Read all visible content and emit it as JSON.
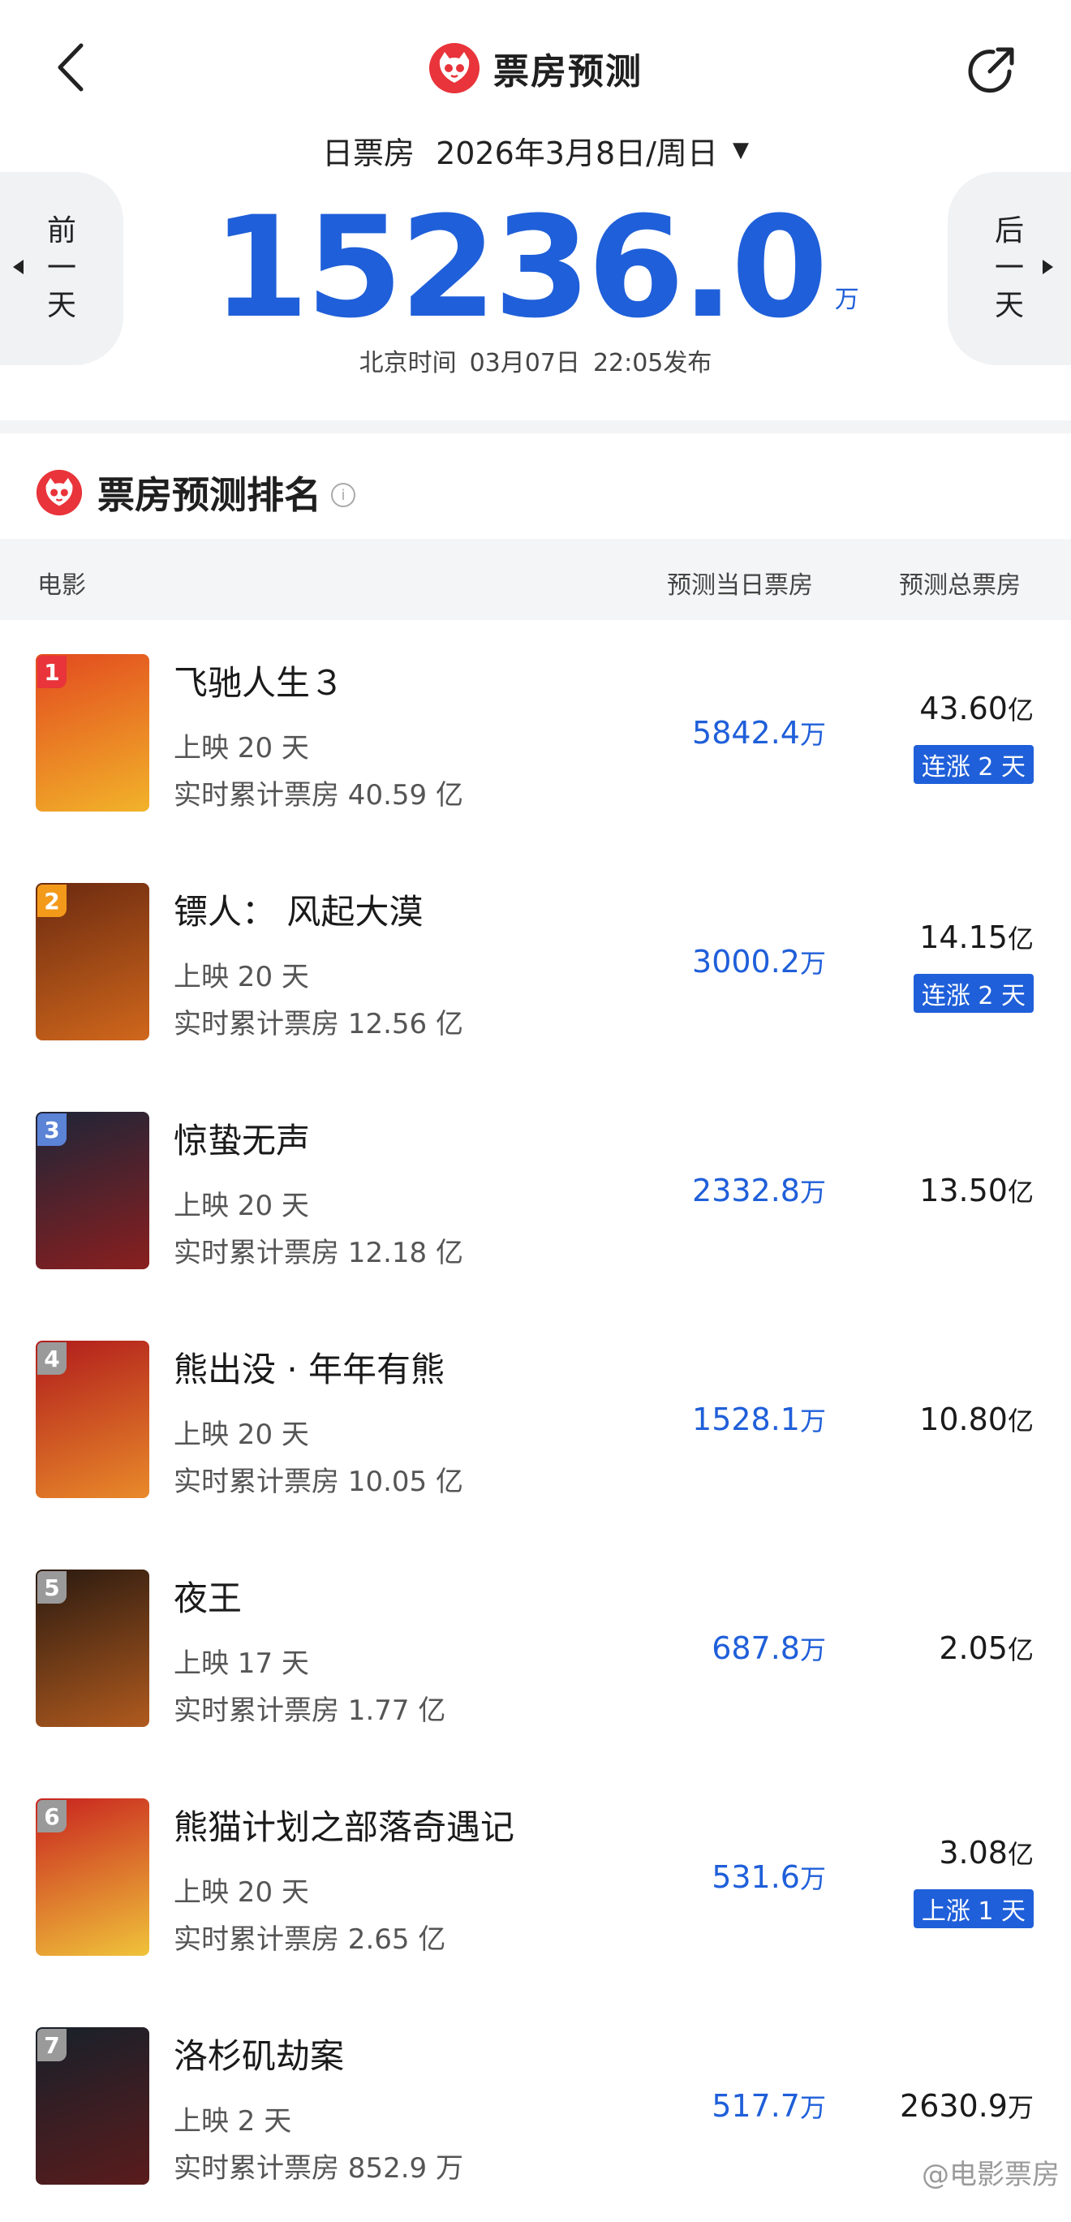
{
  "header": {
    "title": "票房预测",
    "back_icon": "chevron-left-icon",
    "share_icon": "share-icon",
    "logo": "cat-logo-icon"
  },
  "date_selector": {
    "label": "日票房",
    "value": "2026年3月8日/周日"
  },
  "nav": {
    "prev": [
      "前",
      "一",
      "天"
    ],
    "next": [
      "后",
      "一",
      "天"
    ]
  },
  "total": {
    "value": "15236.0",
    "unit": "万",
    "publish_label": "北京时间",
    "publish_date": "03月07日",
    "publish_time": "22:05发布"
  },
  "ranking": {
    "title": "票房预测排名",
    "columns": {
      "movie": "电影",
      "daily": "预测当日票房",
      "total": "预测总票房"
    },
    "movies": [
      {
        "rank": "1",
        "name": "飞驰人生３",
        "days": "上映 20 天",
        "cumulative": "实时累计票房 40.59 亿",
        "daily_value": "5842.4",
        "daily_unit": "万",
        "total_value": "43.60",
        "total_unit": "亿",
        "tag": "连涨 2 天",
        "badge_color": "#e8343a",
        "poster_colors": [
          "#e24a1f",
          "#f2b32a"
        ]
      },
      {
        "rank": "2",
        "name": "镖人： 风起大漠",
        "days": "上映 20 天",
        "cumulative": "实时累计票房 12.56 亿",
        "daily_value": "3000.2",
        "daily_unit": "万",
        "total_value": "14.15",
        "total_unit": "亿",
        "tag": "连涨 2 天",
        "badge_color": "#f39a1a",
        "poster_colors": [
          "#6b2a10",
          "#d0671c"
        ]
      },
      {
        "rank": "3",
        "name": "惊蛰无声",
        "days": "上映 20 天",
        "cumulative": "实时累计票房 12.18 亿",
        "daily_value": "2332.8",
        "daily_unit": "万",
        "total_value": "13.50",
        "total_unit": "亿",
        "tag": "",
        "badge_color": "#5b83d6",
        "poster_colors": [
          "#1d2538",
          "#8a1f1f"
        ]
      },
      {
        "rank": "4",
        "name": "熊出没 · 年年有熊",
        "days": "上映 20 天",
        "cumulative": "实时累计票房 10.05 亿",
        "daily_value": "1528.1",
        "daily_unit": "万",
        "total_value": "10.80",
        "total_unit": "亿",
        "tag": "",
        "badge_color": "#9a9a9a",
        "poster_colors": [
          "#b01c1c",
          "#e98a2a"
        ]
      },
      {
        "rank": "5",
        "name": "夜王",
        "days": "上映 17 天",
        "cumulative": "实时累计票房 1.77 亿",
        "daily_value": "687.8",
        "daily_unit": "万",
        "total_value": "2.05",
        "total_unit": "亿",
        "tag": "",
        "badge_color": "#9a9a9a",
        "poster_colors": [
          "#2a1a10",
          "#b05a1e"
        ]
      },
      {
        "rank": "6",
        "name": "熊猫计划之部落奇遇记",
        "days": "上映 20 天",
        "cumulative": "实时累计票房 2.65 亿",
        "daily_value": "531.6",
        "daily_unit": "万",
        "total_value": "3.08",
        "total_unit": "亿",
        "tag": "上涨 1 天",
        "badge_color": "#9a9a9a",
        "poster_colors": [
          "#c8231f",
          "#f0c33a"
        ]
      },
      {
        "rank": "7",
        "name": "洛杉矶劫案",
        "days": "上映 2 天",
        "cumulative": "实时累计票房 852.9 万",
        "daily_value": "517.7",
        "daily_unit": "万",
        "total_value": "2630.9",
        "total_unit": "万",
        "tag": "",
        "badge_color": "#9a9a9a",
        "poster_colors": [
          "#17202a",
          "#5a1c1c"
        ]
      }
    ]
  },
  "watermark": "@电影票房",
  "colors": {
    "accent": "#1f5fd9",
    "logo_red": "#e8343a"
  }
}
